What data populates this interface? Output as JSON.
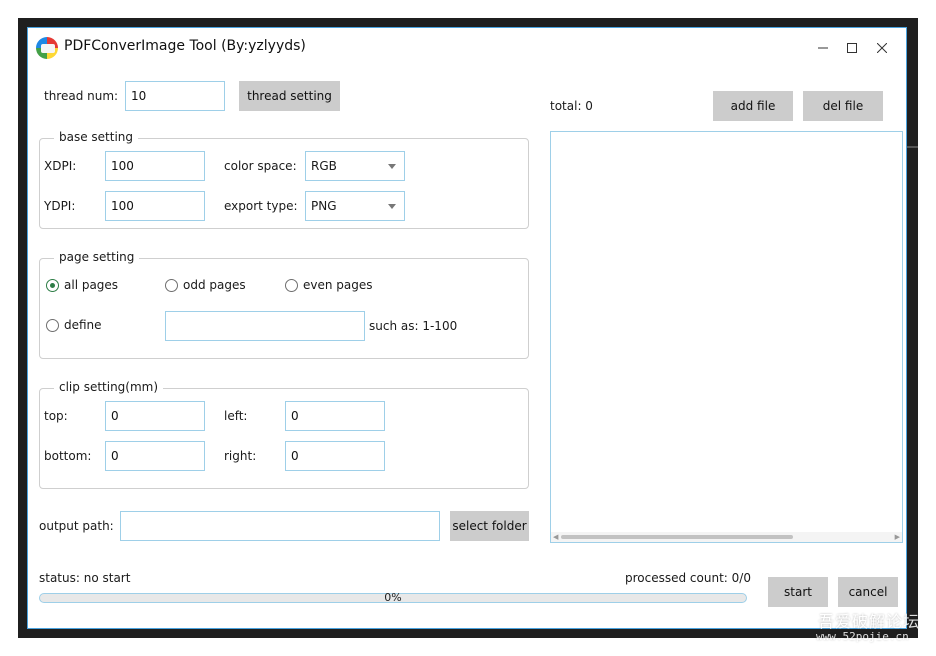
{
  "window": {
    "title": "PDFConverImage Tool (By:yzlyyds)"
  },
  "thread": {
    "label": "thread num:",
    "value": "10",
    "button": "thread setting"
  },
  "base_setting": {
    "title": "base setting",
    "xdpi_label": "XDPI:",
    "xdpi_value": "100",
    "ydpi_label": "YDPI:",
    "ydpi_value": "100",
    "color_space_label": "color space:",
    "color_space_value": "RGB",
    "export_type_label": "export type:",
    "export_type_value": "PNG"
  },
  "page_setting": {
    "title": "page setting",
    "all_pages": "all pages",
    "odd_pages": "odd pages",
    "even_pages": "even pages",
    "define": "define",
    "define_value": "",
    "hint": "such as: 1-100",
    "selected": "all_pages"
  },
  "clip_setting": {
    "title": "clip setting(mm)",
    "top_label": "top:",
    "top_value": "0",
    "left_label": "left:",
    "left_value": "0",
    "bottom_label": "bottom:",
    "bottom_value": "0",
    "right_label": "right:",
    "right_value": "0"
  },
  "output": {
    "label": "output path:",
    "value": "",
    "button": "select folder"
  },
  "files": {
    "total": "total: 0",
    "add_button": "add file",
    "del_button": "del file",
    "items": []
  },
  "status": {
    "text": "status: no start",
    "processed": "processed count: 0/0",
    "progress_text": "0%",
    "progress": 0
  },
  "actions": {
    "start": "start",
    "cancel": "cancel"
  },
  "watermark": {
    "line1": "吾爱破解论坛",
    "line2": "www.52pojie.cn"
  },
  "colors": {
    "accent": "#4aa3df",
    "button_bg": "#cccccc",
    "radio_on": "#2d7d46"
  }
}
